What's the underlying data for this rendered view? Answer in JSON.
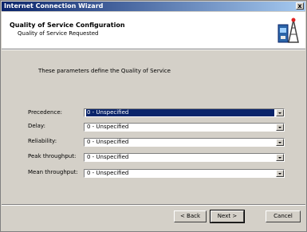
{
  "window": {
    "title": "Internet Connection Wizard",
    "close_glyph": "x"
  },
  "header": {
    "title": "Quality of Service Configuration",
    "subtitle": "Quality of Service Requested",
    "icon": "network-connection-icon"
  },
  "description": "These parameters define the Quality of Service",
  "fields": [
    {
      "label": "Precedence:",
      "value": "0 - Unspecified",
      "selected": true
    },
    {
      "label": "Delay:",
      "value": "0 - Unspecified",
      "selected": false
    },
    {
      "label": "Reliability:",
      "value": "0 - Unspecified",
      "selected": false
    },
    {
      "label": "Peak throughput:",
      "value": "0 - Unspecified",
      "selected": false
    },
    {
      "label": "Mean throughput:",
      "value": "0 - Unspecified",
      "selected": false
    }
  ],
  "buttons": {
    "back": "< Back",
    "next": "Next >",
    "cancel": "Cancel"
  },
  "colors": {
    "title_bar": "#0a246a",
    "selection": "#0a246a",
    "dialog_face": "#d4d0c8"
  }
}
